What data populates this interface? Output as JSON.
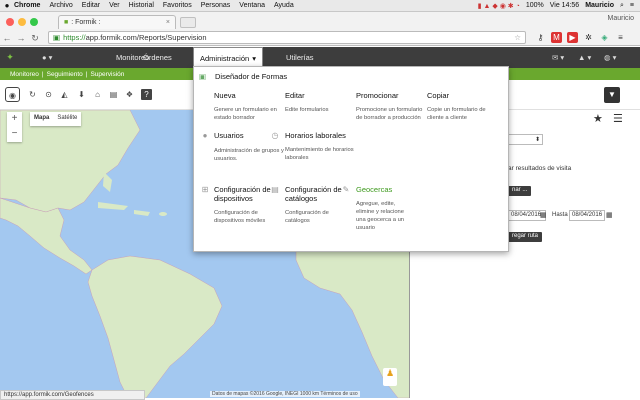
{
  "macos": {
    "apple": "",
    "app": "Chrome",
    "menus": [
      "Archivo",
      "Editar",
      "Ver",
      "Historial",
      "Favoritos",
      "Personas",
      "Ventana",
      "Ayuda"
    ],
    "battery": "100%",
    "clock": "Vie 14:56",
    "user": "Mauricio"
  },
  "browser": {
    "tab_title": ": Formik :",
    "profile": "Mauricio",
    "url_scheme": "https://",
    "url_rest": "app.formik.com/Reports/Supervision"
  },
  "app": {
    "topnav": {
      "monitoreo": "Monitoreo",
      "ordenes": "Órdenes",
      "administracion": "Administración",
      "utilerias": "Utilerías"
    },
    "breadcrumb": [
      "Monitoreo",
      "Seguimiento",
      "Supervisión"
    ],
    "map": {
      "type_map": "Mapa",
      "type_sat": "Satélite",
      "zoom_in": "+",
      "zoom_out": "−",
      "attribution": "Datos de mapas ©2016 Google, INEGI   1000 km      Términos de uso"
    },
    "panel": {
      "filter_text": "ar resultados de visita",
      "btn1": "nar ...",
      "date_from": "08/04/2016",
      "hasta": "Hasta",
      "date_to": "08/04/2016",
      "btn2": "regar ruta"
    },
    "status_url": "https://app.formik.com/Geofences"
  },
  "admin_menu": {
    "header": "Diseñador de Formas",
    "row1": [
      {
        "title": "Nueva",
        "desc": "Genere un formulario en estado borrador"
      },
      {
        "title": "Editar",
        "desc": "Edite formularios"
      },
      {
        "title": "Promocionar",
        "desc": "Promocione un formulario de borrador a producción"
      },
      {
        "title": "Copiar",
        "desc": "Copie un formulario de cliente a cliente"
      }
    ],
    "row2": [
      {
        "title": "Usuarios",
        "desc": "Administración de grupos y usuarios."
      },
      {
        "title": "Horarios laborales",
        "desc": "Mantenimiento de horarios laborales"
      }
    ],
    "row3": [
      {
        "title": "Configuración de dispositivos",
        "desc": "Configuración de dispositivos móviles"
      },
      {
        "title": "Configuración de catálogos",
        "desc": "Configuración de catálogos"
      },
      {
        "title": "Geocercas",
        "desc": "Agregue, edite, elimine y relacione una geocerca a un usuario"
      }
    ]
  },
  "colors": {
    "topbar": "#3d3d3d",
    "accent_green": "#6aa82e",
    "ocean": "#a3c8f0",
    "land": "#d9e9c6"
  }
}
